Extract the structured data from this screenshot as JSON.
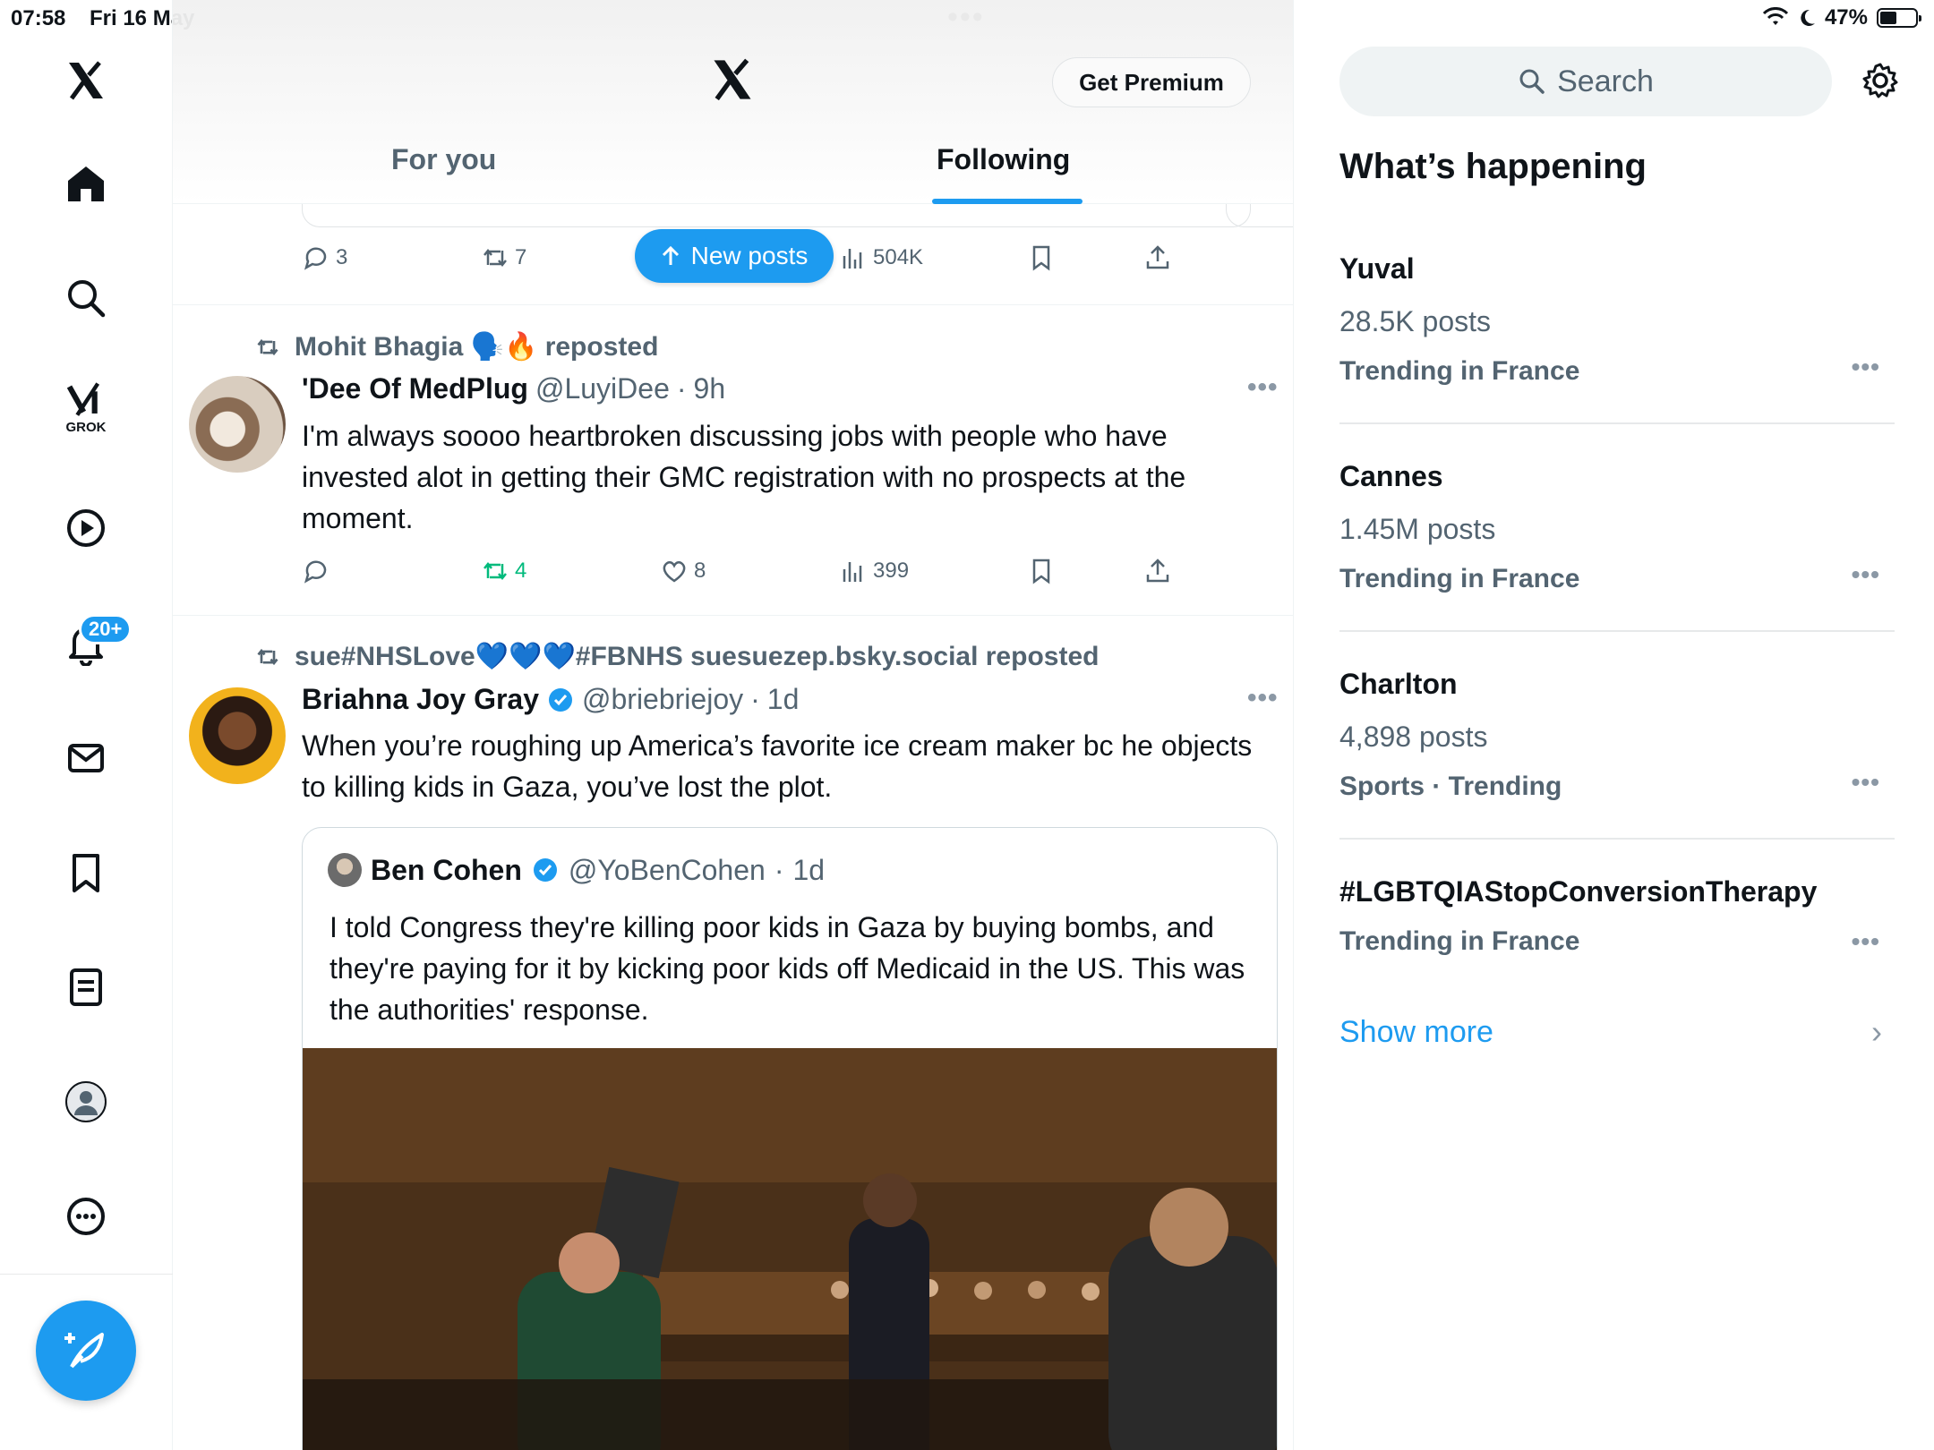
{
  "status_bar": {
    "time": "07:58",
    "date": "Fri 16 May",
    "battery": "47%"
  },
  "header": {
    "get_premium": "Get Premium",
    "tabs": [
      {
        "label": "For you"
      },
      {
        "label": "Following"
      }
    ],
    "new_posts": "New posts"
  },
  "nav": {
    "grok_label": "GROK",
    "notifications_badge": "20+"
  },
  "feed": {
    "post0": {
      "replies": "3",
      "reposts": "7",
      "views": "504K"
    },
    "post1": {
      "repost_by": "Mohit Bhagia 🗣️🔥 reposted",
      "name": "'Dee Of MedPlug",
      "handle": "@LuyiDee",
      "time": "9h",
      "text": "I'm always soooo heartbroken discussing jobs with people who have invested alot in getting their GMC registration with no prospects at the moment.",
      "reposts": "4",
      "likes": "8",
      "views": "399"
    },
    "post2": {
      "repost_by": "sue#NHSLove💙💙💙#FBNHS suesuezep.bsky.social reposted",
      "name": "Briahna Joy Gray",
      "handle": "@briebriejoy",
      "time": "1d",
      "text": "When you’re roughing up America’s favorite ice cream maker bc he objects to killing kids in Gaza, you’ve lost the plot.",
      "quote": {
        "name": "Ben Cohen",
        "handle": "@YoBenCohen",
        "time": "1d",
        "text": "I told Congress they're killing poor kids in Gaza by buying bombs, and they're paying for it by kicking poor kids off Medicaid in the US. This was the authorities' response."
      }
    }
  },
  "sidebar": {
    "search_placeholder": "Search",
    "section_title": "What’s happening",
    "trends": [
      {
        "name": "Yuval",
        "count": "28.5K posts",
        "meta": "Trending in France"
      },
      {
        "name": "Cannes",
        "count": "1.45M posts",
        "meta": "Trending in France"
      },
      {
        "name": "Charlton",
        "count": "4,898 posts",
        "meta": "Sports · Trending"
      },
      {
        "name": "#LGBTQIAStopConversionTherapy",
        "count": "",
        "meta": "Trending in France"
      }
    ],
    "show_more": "Show more"
  },
  "colors": {
    "accent": "#1d9bf0",
    "repost_green": "#00ba7c",
    "muted": "#536471"
  }
}
